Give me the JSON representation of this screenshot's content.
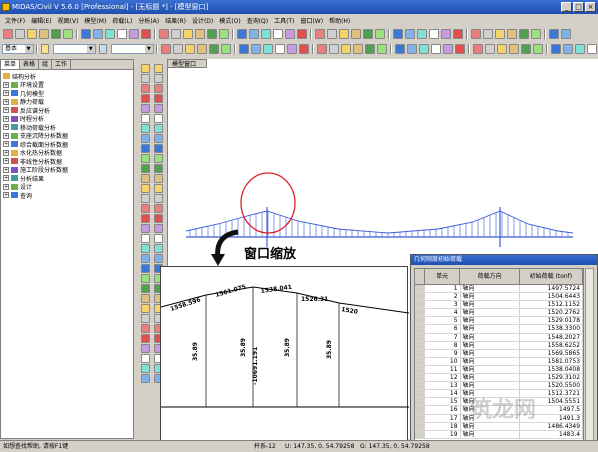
{
  "window": {
    "title": "MIDAS/Civil V 5.6.0 [Professional] - [无标题 *] - [模型窗口]"
  },
  "menu": [
    "文件(F)",
    "编辑(E)",
    "视图(V)",
    "模型(M)",
    "荷载(L)",
    "分析(A)",
    "结果(R)",
    "设计(D)",
    "模式(O)",
    "查询(Q)",
    "工具(T)",
    "窗口(W)",
    "帮助(H)"
  ],
  "toolbar": {
    "unit_combo": "基本"
  },
  "left_tabs": [
    "菜单",
    "表格",
    "组",
    "工作"
  ],
  "tree": {
    "root": "结构分析",
    "items": [
      "环境设置",
      "几何模型",
      "静力荷载",
      "反应谱分析",
      "时程分析",
      "移动荷载分析",
      "支座沉降分析数据",
      "综合截面分析数据",
      "水化热分析数据",
      "非线性分析数据",
      "施工阶段分析数据",
      "分析结果",
      "设计",
      "查询"
    ]
  },
  "viewport": {
    "tab": "模型窗口"
  },
  "zoom_label": "窗口缩放",
  "inset": {
    "labels": [
      "1558.596",
      "1561.075",
      "1538.041",
      "1526.31",
      "1520",
      "35.89",
      "35.89",
      "-10691.191",
      "35.89",
      "35.89"
    ]
  },
  "dialog": {
    "title": "几何刚度初始荷载",
    "headers": [
      "单元",
      "荷载方向",
      "初始荷载\n(tonf)"
    ],
    "rows": [
      [
        "1",
        "轴向",
        "1497.5724"
      ],
      [
        "2",
        "轴向",
        "1504.6443"
      ],
      [
        "3",
        "轴向",
        "1512.1152"
      ],
      [
        "4",
        "轴向",
        "1520.2762"
      ],
      [
        "5",
        "轴向",
        "1529.0178"
      ],
      [
        "6",
        "轴向",
        "1538.3300"
      ],
      [
        "7",
        "轴向",
        "1548.2027"
      ],
      [
        "8",
        "轴向",
        "1558.6252"
      ],
      [
        "9",
        "轴向",
        "1569.5865"
      ],
      [
        "10",
        "轴向",
        "1581.0753"
      ],
      [
        "11",
        "轴向",
        "1538.0408"
      ],
      [
        "12",
        "轴向",
        "1529.3102"
      ],
      [
        "13",
        "轴向",
        "1520.5500"
      ],
      [
        "14",
        "轴向",
        "1512.3721"
      ],
      [
        "15",
        "轴向",
        "1504.5551"
      ],
      [
        "16",
        "轴向",
        "1497.5"
      ],
      [
        "17",
        "轴向",
        "1491.3"
      ],
      [
        "18",
        "轴向",
        "1486.4349"
      ],
      [
        "19",
        "轴向",
        "1483.4"
      ]
    ]
  },
  "status": {
    "left": "如想查找帮助, 请按F1键",
    "mid": "杆系-12",
    "coord1": "U: 147.35, 0, 54.79258",
    "coord2": "G: 147.35, 0, 54.79258"
  }
}
